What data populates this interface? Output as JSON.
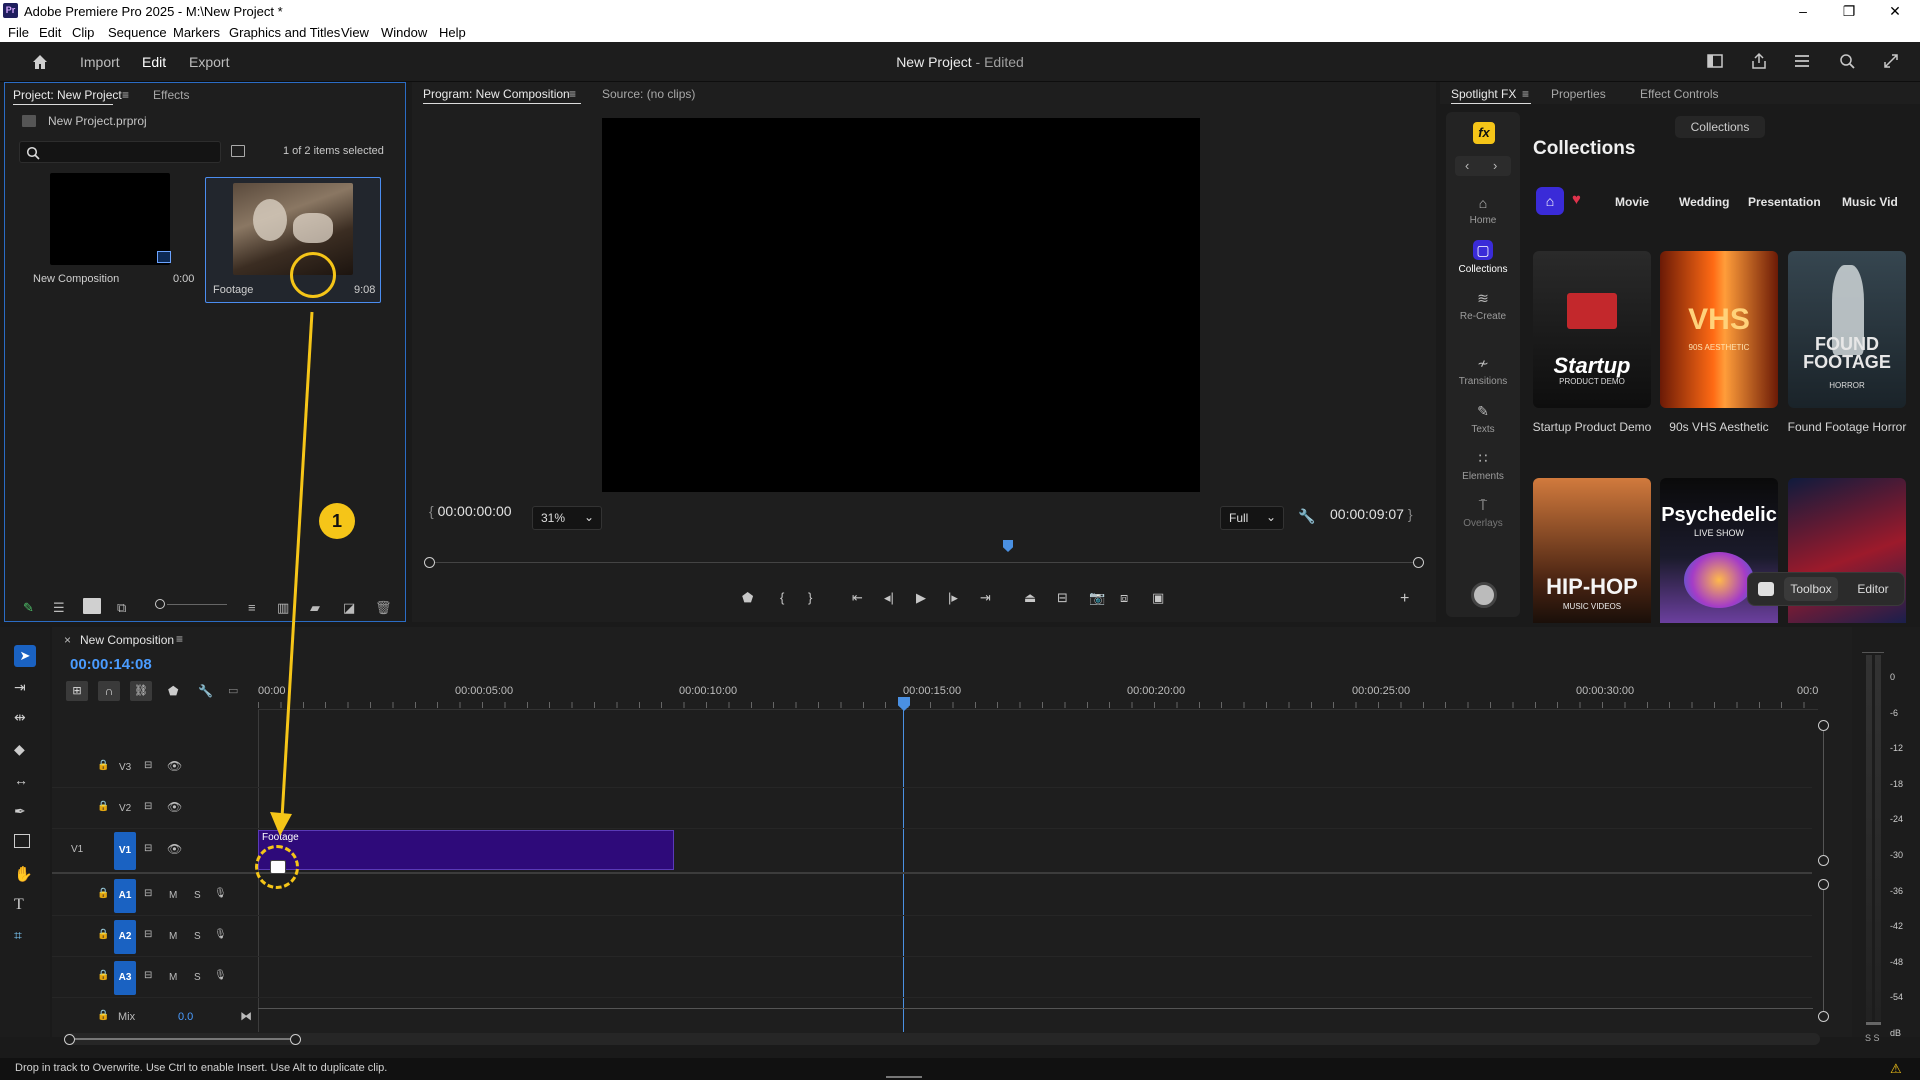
{
  "app": {
    "title": "Adobe Premiere Pro 2025 - M:\\New Project *",
    "logo": "Pr",
    "window_controls": [
      "minimize-icon",
      "maximize-icon",
      "close-icon"
    ]
  },
  "menu": [
    "File",
    "Edit",
    "Clip",
    "Sequence",
    "Markers",
    "Graphics and Titles",
    "View",
    "Window",
    "Help"
  ],
  "topbar": {
    "tabs": [
      "Import",
      "Edit",
      "Export"
    ],
    "active_tab": "Edit",
    "project_title": "New Project",
    "project_status": "- Edited"
  },
  "project_panel": {
    "tab_active": "Project: New Project",
    "tab_other": "Effects",
    "file": "New Project.prproj",
    "search_placeholder": "",
    "selection": "1 of 2 items selected",
    "items": [
      {
        "name": "New Composition",
        "duration": "0:00"
      },
      {
        "name": "Footage",
        "duration": "9:08"
      }
    ]
  },
  "program_panel": {
    "tab_active": "Program: New Composition",
    "tab_other": "Source: (no clips)",
    "timecode_in": "00:00:00:00",
    "zoom": "31%",
    "quality": "Full",
    "timecode_out": "00:00:09:07"
  },
  "spotlight": {
    "tabs": [
      "Spotlight FX",
      "Properties",
      "Effect Controls"
    ],
    "fx_badge": "fx",
    "collections_pill": "Collections",
    "heading": "Collections",
    "nav": [
      "Home",
      "Collections",
      "Re-Create",
      "Transitions",
      "Texts",
      "Elements",
      "Overlays"
    ],
    "filters": [
      "Movie",
      "Wedding",
      "Presentation",
      "Music Vid"
    ],
    "cards": [
      {
        "label": "Startup Product Demo",
        "overlay": "Startup",
        "overlay_sub": "PRODUCT DEMO"
      },
      {
        "label": "90s VHS Aesthetic",
        "overlay": "VHS",
        "overlay_sub": "90S AESTHETIC"
      },
      {
        "label": "Found Footage Horror",
        "overlay": "FOUND FOOTAGE",
        "overlay_sub": "HORROR"
      }
    ],
    "cards_row2": [
      {
        "overlay": "HIP-HOP",
        "overlay_sub": "MUSIC VIDEOS"
      },
      {
        "overlay": "Psychedelic",
        "overlay_sub": "LIVE SHOW"
      },
      {
        "overlay": "",
        "overlay_sub": ""
      }
    ],
    "toolbox_label": "Toolbox",
    "editor_label": "Editor"
  },
  "timeline": {
    "sequence_name": "New Composition",
    "timecode": "00:00:14:08",
    "ruler": [
      "00:00",
      "00:00:05:00",
      "00:00:10:00",
      "00:00:15:00",
      "00:00:20:00",
      "00:00:25:00",
      "00:00:30:00",
      "00:0"
    ],
    "video_tracks": [
      "V3",
      "V2",
      "V1"
    ],
    "audio_tracks": [
      "A1",
      "A2",
      "A3"
    ],
    "source_patch": "V1",
    "m_label": "M",
    "s_label": "S",
    "mix_label": "Mix",
    "mix_value": "0.0",
    "clip_name": "Footage",
    "clip_color": "#2e0a7a",
    "annotation_number": "1"
  },
  "meter": {
    "labels": [
      "0",
      "-6",
      "-12",
      "-18",
      "-24",
      "-30",
      "-36",
      "-42",
      "-48",
      "-54",
      "dB"
    ],
    "solo_label": "S S"
  },
  "status": {
    "text": "Drop in track to Overwrite. Use Ctrl to enable Insert. Use Alt to duplicate clip."
  },
  "colors": {
    "accent": "#2b6cc4",
    "annotation": "#f5c518",
    "clip": "#2e0a7a",
    "playhead": "#4a90e2"
  }
}
